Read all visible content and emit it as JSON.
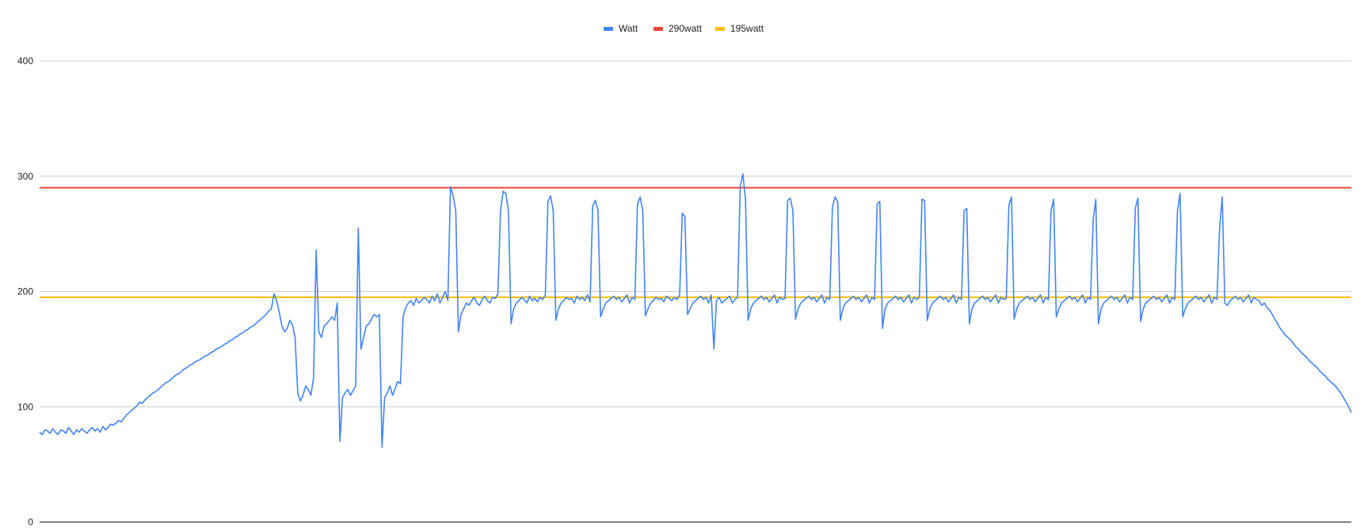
{
  "chart_data": {
    "type": "line",
    "title": "",
    "xlabel": "",
    "ylabel": "",
    "ylim": [
      0,
      400
    ],
    "yticks": [
      0,
      100,
      200,
      300,
      400
    ],
    "grid": true,
    "legend_position": "top",
    "legend": [
      "Watt",
      "290watt",
      "195watt"
    ],
    "series": [
      {
        "name": "Watt",
        "color": "#4285f4",
        "values": [
          78,
          76,
          80,
          79,
          77,
          81,
          78,
          76,
          80,
          79,
          77,
          82,
          79,
          76,
          80,
          78,
          81,
          79,
          77,
          80,
          82,
          79,
          81,
          78,
          83,
          80,
          82,
          85,
          84,
          86,
          88,
          87,
          90,
          93,
          95,
          97,
          99,
          101,
          104,
          103,
          106,
          108,
          110,
          112,
          113,
          115,
          117,
          119,
          121,
          122,
          124,
          126,
          128,
          129,
          131,
          133,
          134,
          136,
          137,
          139,
          140,
          141,
          143,
          144,
          145,
          147,
          148,
          150,
          151,
          152,
          154,
          155,
          157,
          158,
          160,
          161,
          163,
          164,
          166,
          167,
          169,
          170,
          172,
          174,
          176,
          178,
          180,
          183,
          185,
          198,
          192,
          182,
          170,
          165,
          168,
          175,
          171,
          160,
          112,
          105,
          110,
          118,
          115,
          110,
          125,
          236,
          165,
          160,
          170,
          172,
          175,
          178,
          175,
          190,
          70,
          108,
          112,
          115,
          110,
          114,
          118,
          255,
          150,
          160,
          170,
          172,
          176,
          180,
          178,
          180,
          65,
          108,
          112,
          118,
          110,
          116,
          122,
          120,
          178,
          186,
          190,
          192,
          188,
          194,
          190,
          192,
          195,
          193,
          190,
          196,
          192,
          198,
          190,
          195,
          200,
          192,
          291,
          283,
          270,
          165,
          180,
          185,
          190,
          188,
          192,
          195,
          190,
          188,
          193,
          196,
          192,
          190,
          195,
          194,
          198,
          270,
          287,
          285,
          270,
          172,
          185,
          190,
          192,
          195,
          193,
          190,
          196,
          192,
          194,
          191,
          195,
          193,
          197,
          278,
          283,
          270,
          175,
          185,
          190,
          192,
          195,
          193,
          194,
          190,
          196,
          193,
          195,
          192,
          197,
          191,
          274,
          279,
          270,
          178,
          185,
          190,
          192,
          194,
          196,
          193,
          195,
          191,
          194,
          197,
          190,
          195,
          193,
          276,
          282,
          270,
          179,
          185,
          190,
          192,
          195,
          193,
          194,
          191,
          196,
          194,
          192,
          195,
          193,
          197,
          268,
          265,
          180,
          185,
          190,
          192,
          194,
          196,
          193,
          195,
          190,
          197,
          150,
          192,
          195,
          190,
          192,
          194,
          196,
          190,
          193,
          195,
          291,
          302,
          280,
          175,
          185,
          190,
          192,
          194,
          196,
          193,
          195,
          191,
          194,
          197,
          190,
          195,
          193,
          194,
          279,
          281,
          270,
          176,
          185,
          190,
          192,
          194,
          196,
          193,
          195,
          191,
          194,
          197,
          190,
          195,
          193,
          273,
          282,
          278,
          175,
          185,
          190,
          192,
          194,
          196,
          193,
          195,
          191,
          194,
          197,
          190,
          195,
          193,
          276,
          278,
          168,
          185,
          190,
          192,
          194,
          196,
          193,
          195,
          191,
          194,
          197,
          190,
          195,
          193,
          195,
          280,
          279,
          175,
          185,
          190,
          192,
          194,
          196,
          193,
          195,
          191,
          194,
          197,
          190,
          195,
          193,
          270,
          272,
          172,
          185,
          190,
          192,
          194,
          196,
          193,
          195,
          191,
          194,
          197,
          190,
          195,
          193,
          194,
          275,
          282,
          176,
          185,
          190,
          192,
          194,
          196,
          193,
          195,
          191,
          194,
          197,
          190,
          195,
          193,
          270,
          280,
          178,
          185,
          190,
          192,
          194,
          196,
          193,
          195,
          191,
          194,
          197,
          190,
          195,
          193,
          262,
          280,
          172,
          185,
          190,
          192,
          194,
          196,
          193,
          195,
          191,
          194,
          197,
          190,
          195,
          193,
          272,
          281,
          174,
          185,
          190,
          192,
          194,
          196,
          193,
          195,
          191,
          194,
          197,
          190,
          195,
          193,
          270,
          285,
          178,
          185,
          190,
          192,
          194,
          196,
          193,
          195,
          191,
          194,
          197,
          190,
          195,
          193,
          255,
          282,
          190,
          188,
          192,
          194,
          196,
          193,
          195,
          191,
          194,
          197,
          190,
          195,
          193,
          192,
          188,
          190,
          186,
          184,
          180,
          176,
          172,
          168,
          165,
          162,
          160,
          158,
          155,
          152,
          150,
          147,
          145,
          143,
          140,
          138,
          136,
          134,
          131,
          129,
          127,
          124,
          122,
          120,
          118,
          115,
          112,
          108,
          104,
          100,
          95
        ]
      },
      {
        "name": "290watt",
        "color": "#ea4335",
        "value": 290
      },
      {
        "name": "195watt",
        "color": "#fbbc04",
        "value": 195
      }
    ]
  }
}
